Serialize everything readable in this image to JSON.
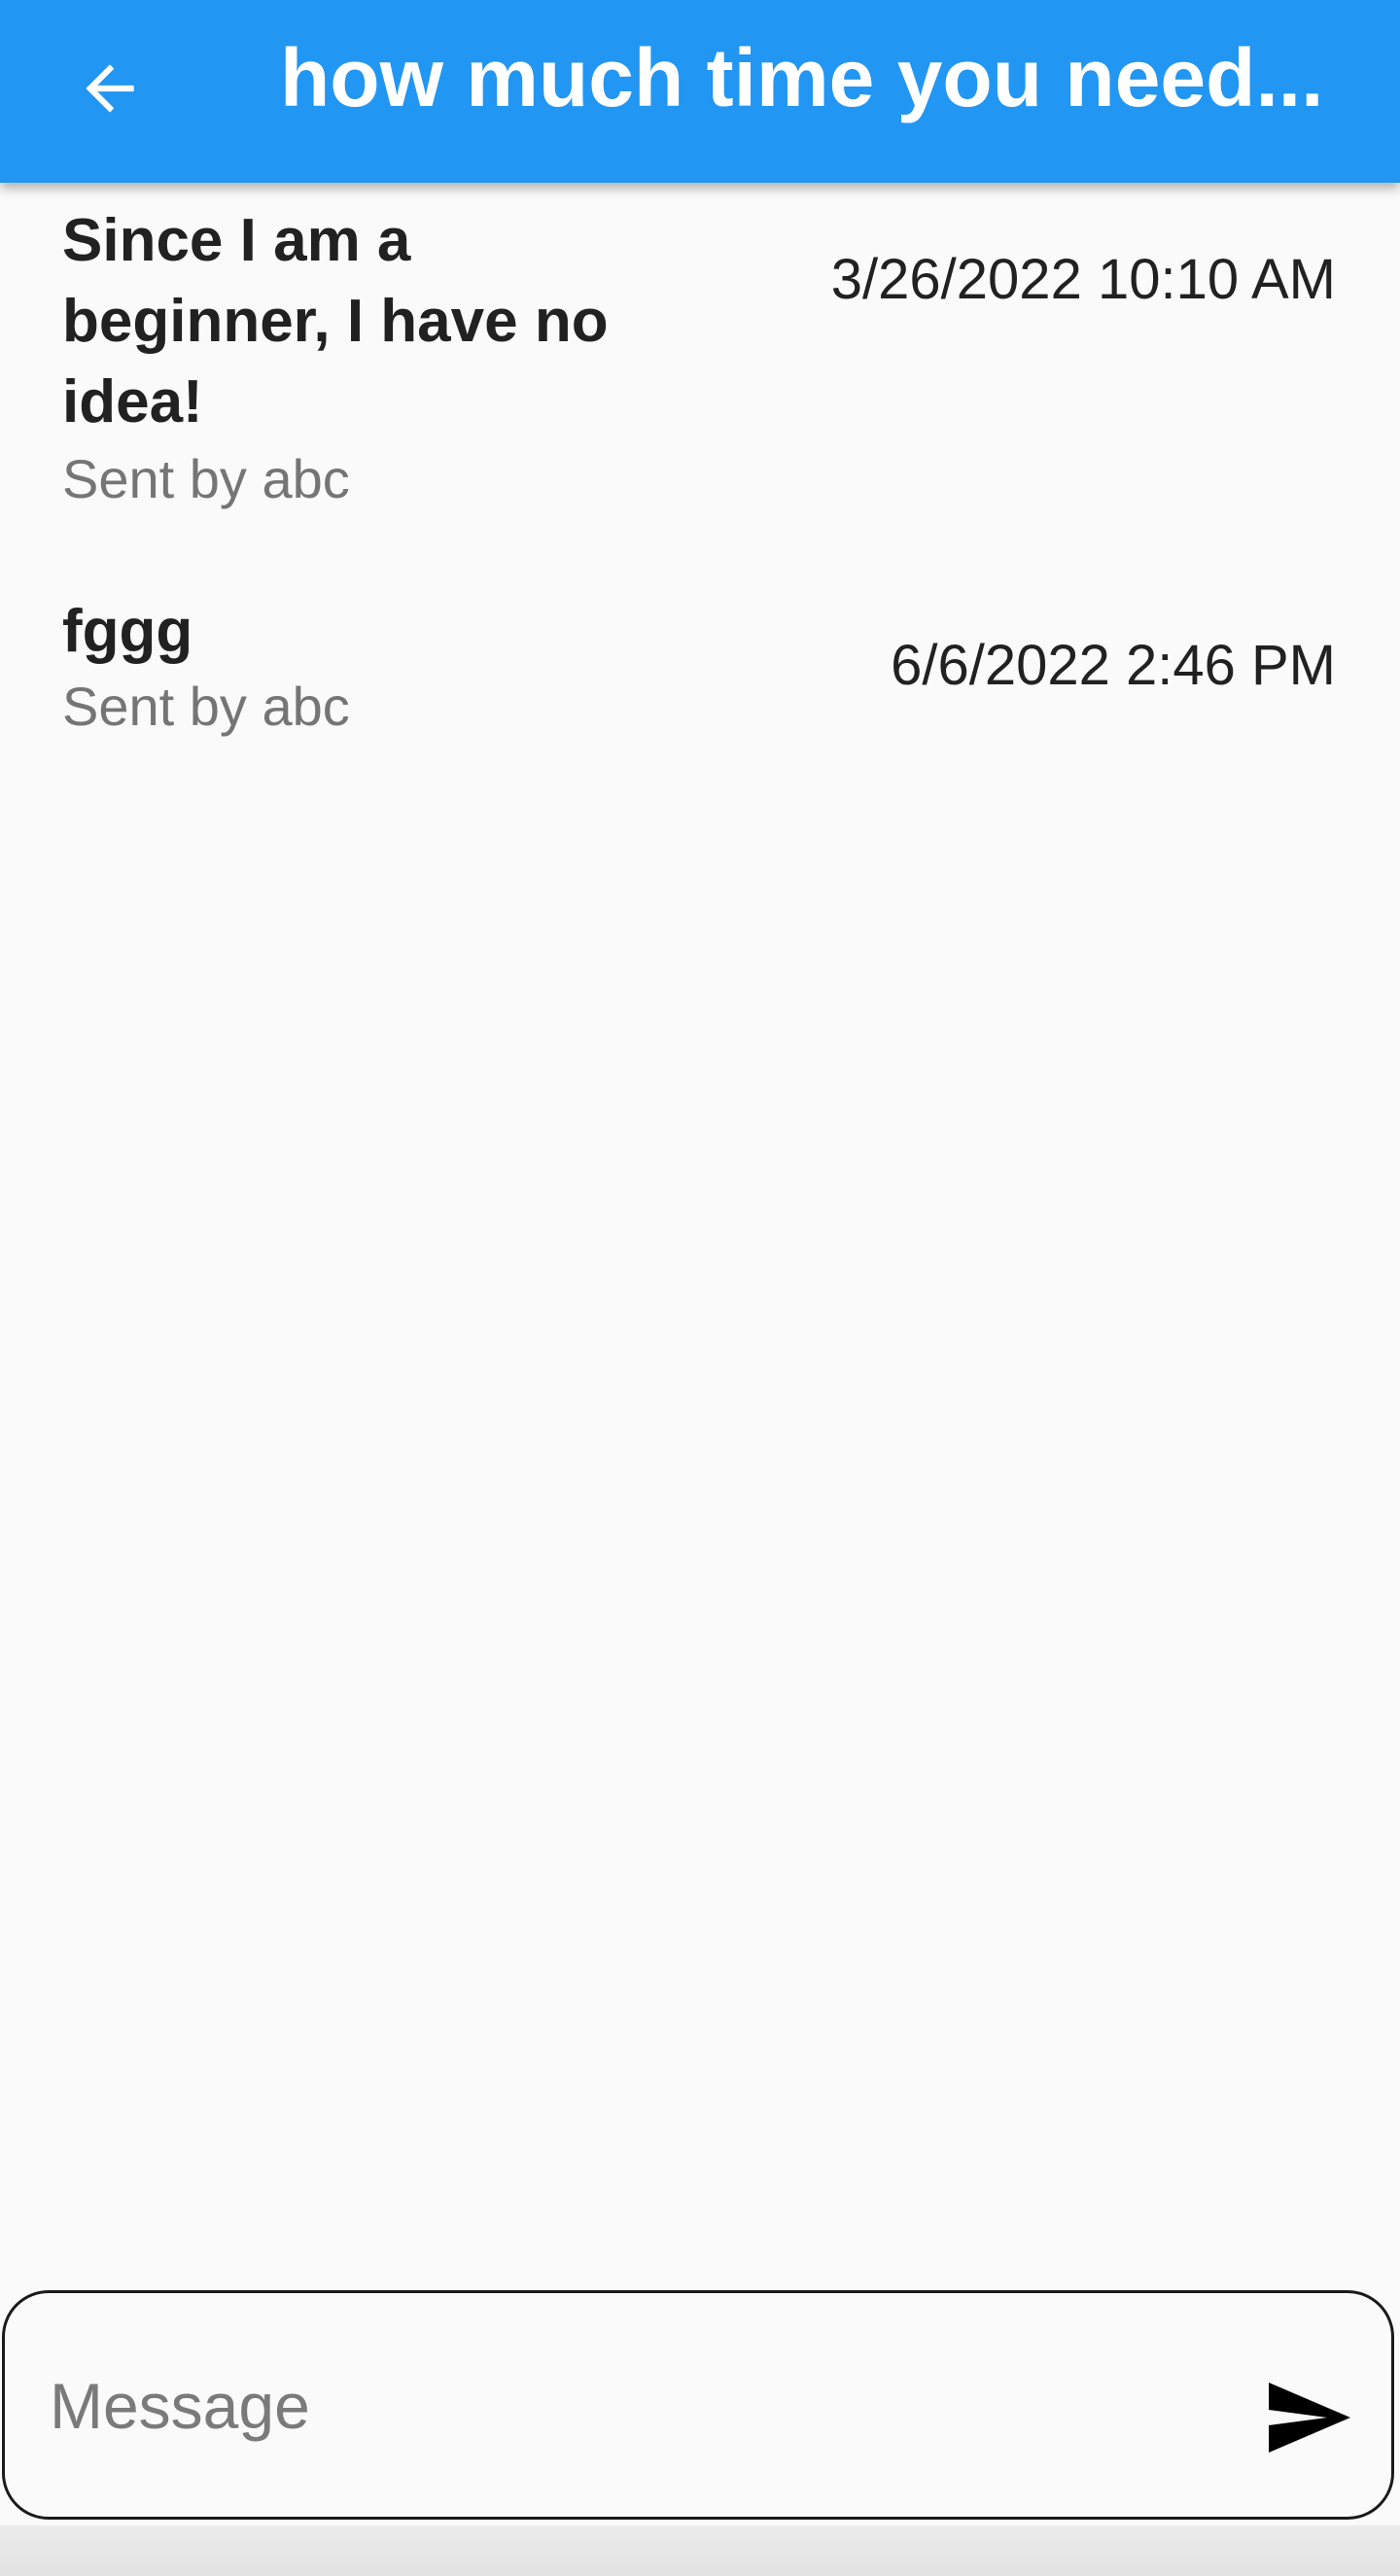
{
  "appbar": {
    "title": "how much time you need...",
    "back_icon": "arrow-back-icon",
    "color": "#2196f3"
  },
  "messages": [
    {
      "text": "Since I am a beginner, I have no idea!",
      "sender": "Sent by abc",
      "time": "3/26/2022 10:10 AM"
    },
    {
      "text": "fggg",
      "sender": "Sent by abc",
      "time": "6/6/2022 2:46 PM"
    }
  ],
  "composer": {
    "placeholder": "Message",
    "value": "",
    "send_icon": "send-icon"
  }
}
